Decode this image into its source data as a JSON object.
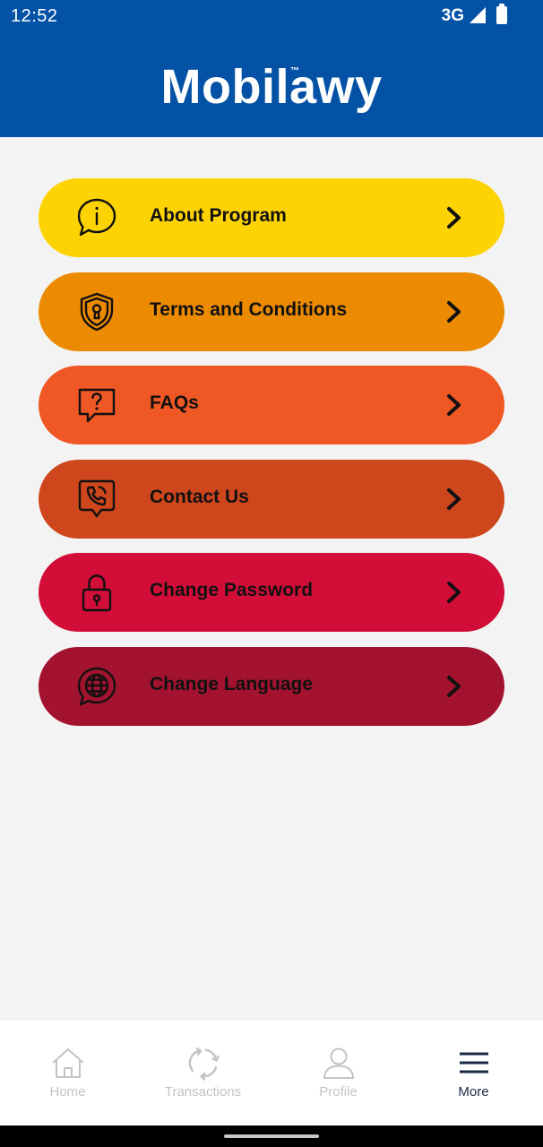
{
  "status_bar": {
    "time": "12:52",
    "network": "3G"
  },
  "header": {
    "logo_text": "Mobilawy",
    "trademark": "™",
    "bg_color": "#0452a6"
  },
  "menu": {
    "items": [
      {
        "label": "About Program",
        "icon": "info-chat-icon",
        "color": "#fdd304"
      },
      {
        "label": "Terms and Conditions",
        "icon": "shield-lock-icon",
        "color": "#ec8b02"
      },
      {
        "label": "FAQs",
        "icon": "question-chat-icon",
        "color": "#ef5824"
      },
      {
        "label": "Contact Us",
        "icon": "phone-chat-icon",
        "color": "#cd461c"
      },
      {
        "label": "Change Password",
        "icon": "padlock-icon",
        "color": "#d10d38"
      },
      {
        "label": "Change Language",
        "icon": "globe-chat-icon",
        "color": "#a3132f"
      }
    ]
  },
  "bottom_nav": {
    "items": [
      {
        "label": "Home",
        "icon": "home-icon",
        "active": false
      },
      {
        "label": "Transactions",
        "icon": "refresh-icon",
        "active": false
      },
      {
        "label": "Profile",
        "icon": "profile-icon",
        "active": false
      },
      {
        "label": "More",
        "icon": "menu-icon",
        "active": true
      }
    ]
  }
}
